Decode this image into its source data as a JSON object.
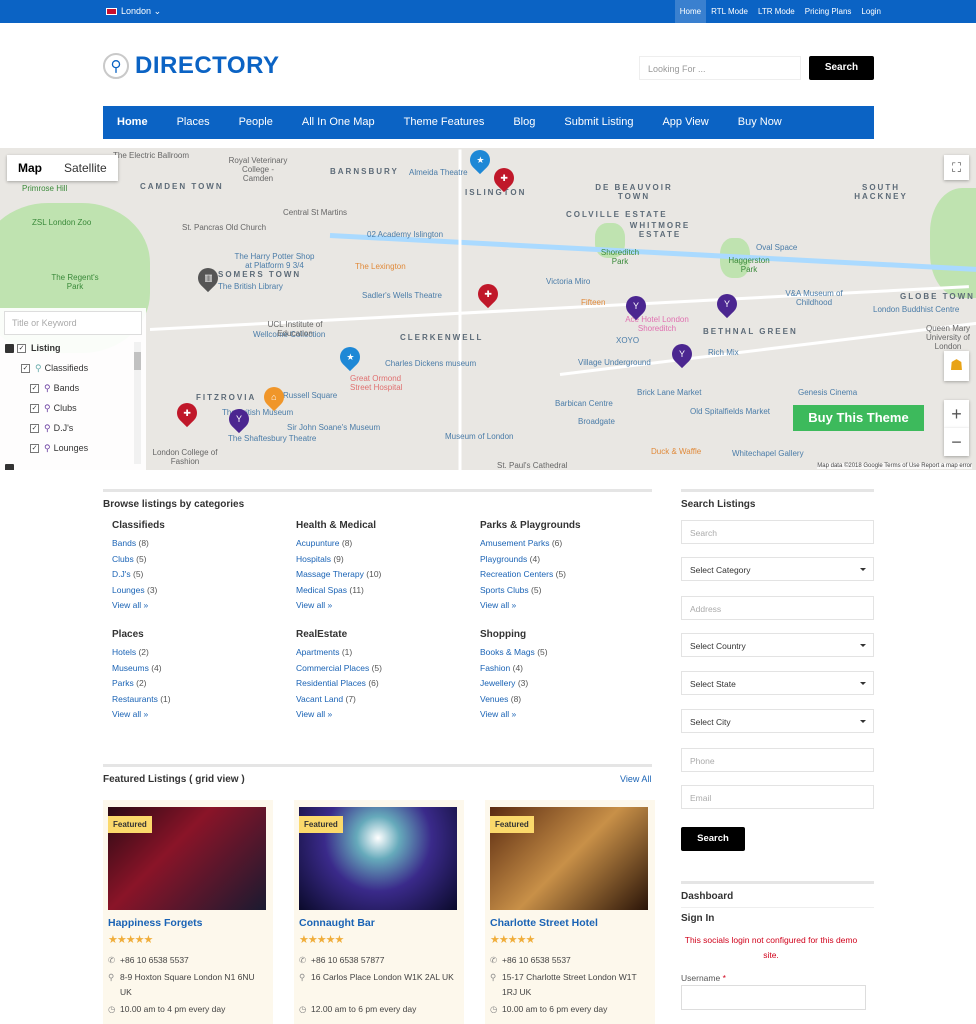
{
  "topbar": {
    "city": "London",
    "links": [
      "Home",
      "RTL Mode",
      "LTR Mode",
      "Pricing Plans",
      "Login"
    ]
  },
  "header": {
    "logo": "DIRECTORY",
    "search_placeholder": "Looking For ...",
    "search_button": "Search"
  },
  "nav": [
    "Home",
    "Places",
    "People",
    "All In One Map",
    "Theme Features",
    "Blog",
    "Submit Listing",
    "App View",
    "Buy Now"
  ],
  "map": {
    "type_map": "Map",
    "type_satellite": "Satellite",
    "filter_placeholder": "Title or Keyword",
    "tree": {
      "root": "Listing",
      "group": "Classifieds",
      "items": [
        "Bands",
        "Clubs",
        "D.J's",
        "Lounges"
      ]
    },
    "buy_button": "Buy This Theme",
    "attribution": "Map data ©2018 Google   Terms of Use   Report a map error",
    "labels": [
      "The Electric Ballroom",
      "Royal Veterinary College - Camden",
      "CAMDEN TOWN",
      "BARNSBURY",
      "Almeida Theatre",
      "ISLINGTON",
      "Primrose Hill",
      "ZSL London Zoo",
      "Central St Martins",
      "St. Pancras Old Church",
      "02 Academy Islington",
      "The Regent's Park",
      "The Harry Potter Shop at Platform 9 3/4",
      "The Lexington",
      "SOMERS TOWN",
      "The British Library",
      "Sadler's Wells Theatre",
      "Wellcome Collection",
      "UCL Institute of Education",
      "CLERKENWELL",
      "Charles Dickens museum",
      "Great Ormond Street Hospital",
      "FITZROVIA",
      "Russell Square",
      "The British Museum",
      "Sir John Soane's Museum",
      "The Shaftesbury Theatre",
      "London College of Fashion",
      "Museum of London",
      "DE BEAUVOIR TOWN",
      "COLVILLE ESTATE",
      "WHITMORE ESTATE",
      "SOUTH HACKNEY",
      "Shoreditch Park",
      "Haggerston Park",
      "Oval Space",
      "Victoria Miro",
      "Fifteen",
      "Ace Hotel London Shoreditch",
      "BETHNAL GREEN",
      "V&A Museum of Childhood",
      "GLOBE TOWN",
      "London Buddhist Centre",
      "XOYO",
      "Rich Mix",
      "Village Underground",
      "Brick Lane Market",
      "Barbican Centre",
      "Old Spitalfields Market",
      "Genesis Cinema",
      "Broadgate",
      "Duck & Waffle",
      "Whitechapel Gallery",
      "St. Paul's Cathedral",
      "Queen Mary University of London"
    ]
  },
  "browse": {
    "title": "Browse listings by categories",
    "view_all": "View all »",
    "categories": [
      {
        "name": "Classifieds",
        "items": [
          [
            "Bands",
            "(8)"
          ],
          [
            "Clubs",
            "(5)"
          ],
          [
            "D.J's",
            "(5)"
          ],
          [
            "Lounges",
            "(3)"
          ]
        ]
      },
      {
        "name": "Health & Medical",
        "items": [
          [
            "Acupunture",
            "(8)"
          ],
          [
            "Hospitals",
            "(9)"
          ],
          [
            "Massage Therapy",
            "(10)"
          ],
          [
            "Medical Spas",
            "(11)"
          ]
        ]
      },
      {
        "name": "Parks & Playgrounds",
        "items": [
          [
            "Amusement Parks",
            "(6)"
          ],
          [
            "Playgrounds",
            "(4)"
          ],
          [
            "Recreation Centers",
            "(5)"
          ],
          [
            "Sports Clubs",
            "(5)"
          ]
        ]
      },
      {
        "name": "Places",
        "items": [
          [
            "Hotels",
            "(2)"
          ],
          [
            "Museums",
            "(4)"
          ],
          [
            "Parks",
            "(2)"
          ],
          [
            "Restaurants",
            "(1)"
          ]
        ]
      },
      {
        "name": "RealEstate",
        "items": [
          [
            "Apartments",
            "(1)"
          ],
          [
            "Commercial Places",
            "(5)"
          ],
          [
            "Residential Places",
            "(6)"
          ],
          [
            "Vacant Land",
            "(7)"
          ]
        ]
      },
      {
        "name": "Shopping",
        "items": [
          [
            "Books & Mags",
            "(5)"
          ],
          [
            "Fashion",
            "(4)"
          ],
          [
            "Jewellery",
            "(3)"
          ],
          [
            "Venues",
            "(8)"
          ]
        ]
      }
    ]
  },
  "featured": {
    "title": "Featured Listings ( grid view )",
    "view_all": "View All",
    "badge": "Featured",
    "stars": "★★★★★",
    "cards": [
      {
        "name": "Happiness Forgets",
        "phone": "+86 10 6538 5537",
        "address": "8-9 Hoxton Square London N1 6NU UK",
        "hours": "10.00 am to 4 pm every day"
      },
      {
        "name": "Connaught Bar",
        "phone": "+86 10 6538 57877",
        "address": "16 Carlos Place London W1K 2AL UK",
        "hours": "12.00 am to 6 pm every day"
      },
      {
        "name": "Charlotte Street Hotel",
        "phone": "+86 10 6538 5537",
        "address": "15-17 Charlotte Street London W1T 1RJ UK",
        "hours": "10.00 am to 6 pm every day"
      }
    ]
  },
  "sidebar": {
    "title": "Search Listings",
    "fields": [
      "Search",
      "Select Category",
      "Address",
      "Select Country",
      "Select State",
      "Select City",
      "Phone",
      "Email"
    ],
    "search_button": "Search",
    "dashboard": "Dashboard",
    "sign_in": "Sign In",
    "error": "This socials login not configured for this demo site.",
    "username_label": "Username",
    "required": "*"
  },
  "colors": {
    "brand": "#0b63c4",
    "buy": "#3dba5c",
    "badge": "#fbd96b",
    "stars": "#f0ad3a",
    "error": "#d0021b"
  }
}
